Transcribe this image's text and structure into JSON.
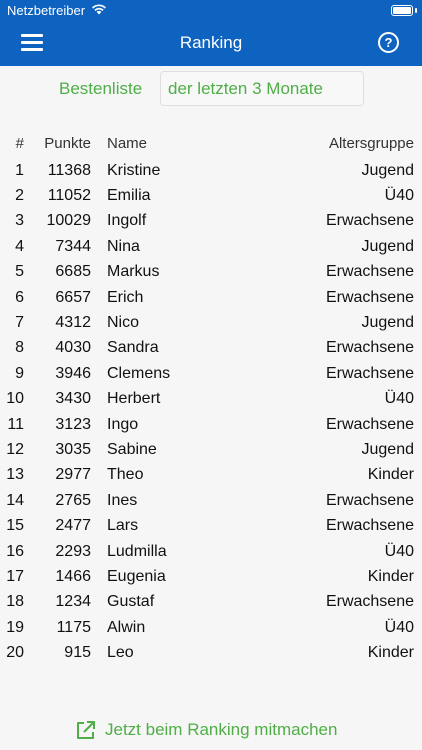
{
  "status_bar": {
    "carrier": "Netzbetreiber"
  },
  "nav": {
    "title": "Ranking",
    "help_label": "?"
  },
  "filter": {
    "label": "Bestenliste",
    "period": "der letzten 3 Monate"
  },
  "table": {
    "headers": {
      "rank": "#",
      "points": "Punkte",
      "name": "Name",
      "group": "Altersgruppe"
    },
    "rows": [
      {
        "rank": "1",
        "points": "11368",
        "name": "Kristine",
        "group": "Jugend"
      },
      {
        "rank": "2",
        "points": "11052",
        "name": "Emilia",
        "group": "Ü40"
      },
      {
        "rank": "3",
        "points": "10029",
        "name": "Ingolf",
        "group": "Erwachsene"
      },
      {
        "rank": "4",
        "points": "7344",
        "name": "Nina",
        "group": "Jugend"
      },
      {
        "rank": "5",
        "points": "6685",
        "name": "Markus",
        "group": "Erwachsene"
      },
      {
        "rank": "6",
        "points": "6657",
        "name": "Erich",
        "group": "Erwachsene"
      },
      {
        "rank": "7",
        "points": "4312",
        "name": "Nico",
        "group": "Jugend"
      },
      {
        "rank": "8",
        "points": "4030",
        "name": "Sandra",
        "group": "Erwachsene"
      },
      {
        "rank": "9",
        "points": "3946",
        "name": "Clemens",
        "group": "Erwachsene"
      },
      {
        "rank": "10",
        "points": "3430",
        "name": "Herbert",
        "group": "Ü40"
      },
      {
        "rank": "11",
        "points": "3123",
        "name": "Ingo",
        "group": "Erwachsene"
      },
      {
        "rank": "12",
        "points": "3035",
        "name": "Sabine",
        "group": "Jugend"
      },
      {
        "rank": "13",
        "points": "2977",
        "name": "Theo",
        "group": "Kinder"
      },
      {
        "rank": "14",
        "points": "2765",
        "name": "Ines",
        "group": "Erwachsene"
      },
      {
        "rank": "15",
        "points": "2477",
        "name": "Lars",
        "group": "Erwachsene"
      },
      {
        "rank": "16",
        "points": "2293",
        "name": "Ludmilla",
        "group": "Ü40"
      },
      {
        "rank": "17",
        "points": "1466",
        "name": "Eugenia",
        "group": "Kinder"
      },
      {
        "rank": "18",
        "points": "1234",
        "name": "Gustaf",
        "group": "Erwachsene"
      },
      {
        "rank": "19",
        "points": "1175",
        "name": "Alwin",
        "group": "Ü40"
      },
      {
        "rank": "20",
        "points": "915",
        "name": "Leo",
        "group": "Kinder"
      }
    ]
  },
  "footer": {
    "join_label": "Jetzt beim Ranking mitmachen",
    "icon": "external-link-icon"
  },
  "colors": {
    "nav_blue": "#0f63c0",
    "accent_green": "#4fae47",
    "background": "#f6f6f6"
  }
}
